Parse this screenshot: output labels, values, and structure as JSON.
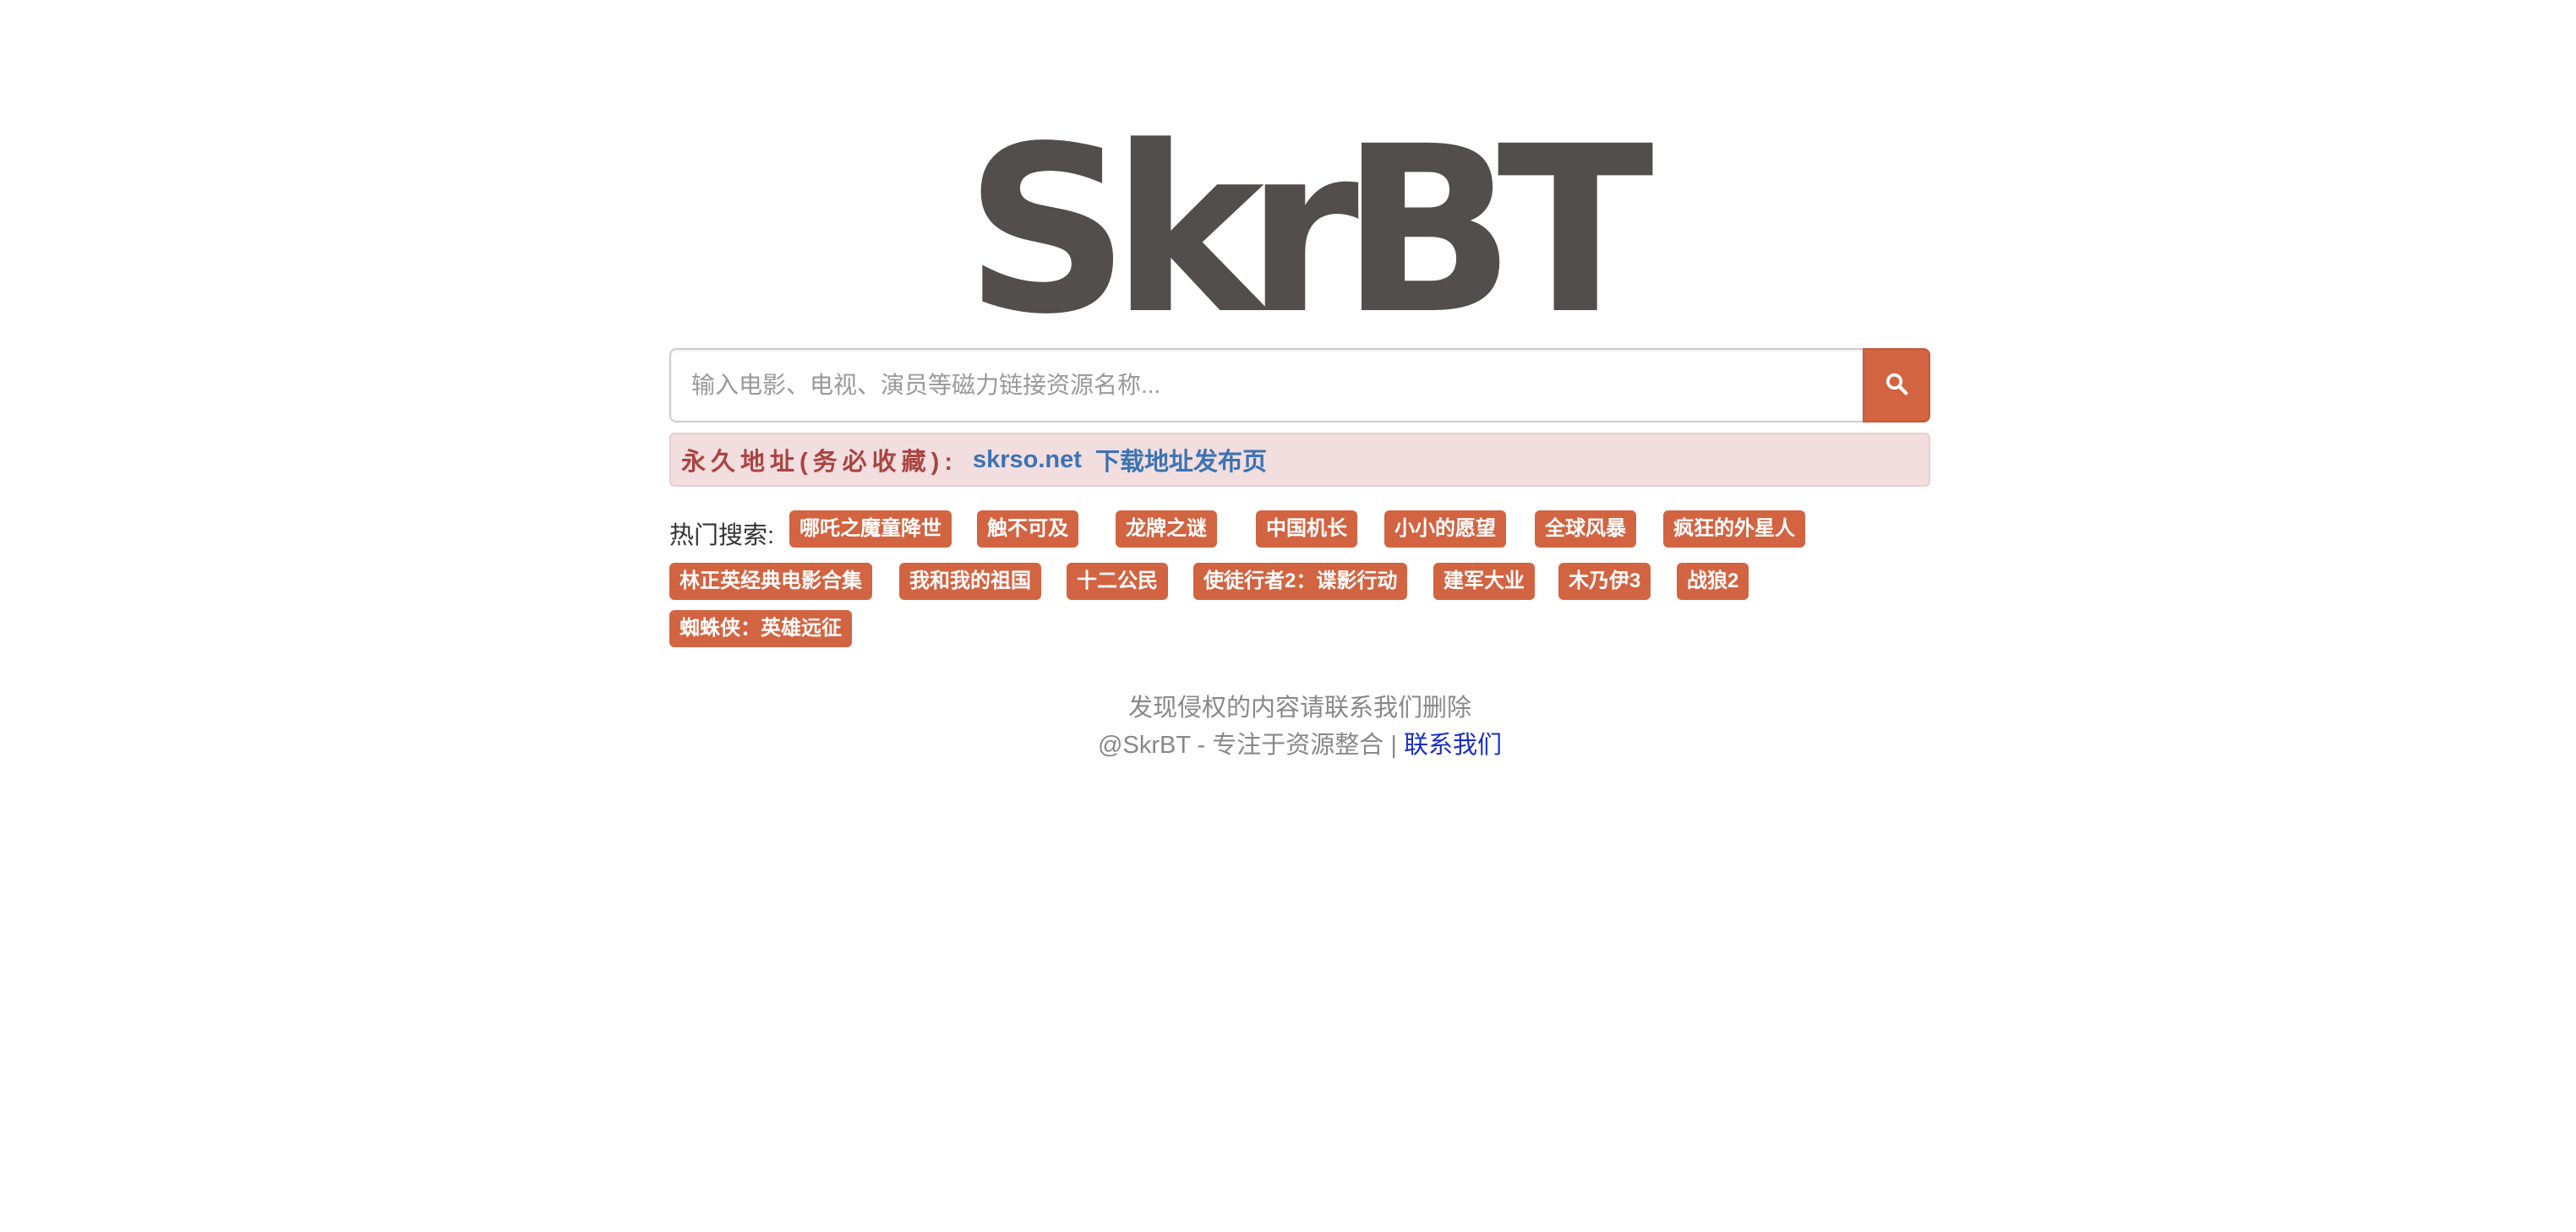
{
  "logo": {
    "text": "SkrBT"
  },
  "search": {
    "placeholder": "输入电影、电视、演员等磁力链接资源名称...",
    "button_icon": "search-icon"
  },
  "notice": {
    "label": "永久地址(务必收藏):",
    "link1": "skrso.net",
    "link2": "下载地址发布页"
  },
  "hot": {
    "title": "热门搜索:",
    "tags": [
      "哪吒之魔童降世",
      "触不可及",
      "龙牌之谜",
      "中国机长",
      "小小的愿望",
      "全球风暴",
      "疯狂的外星人",
      "林正英经典电影合集",
      "我和我的祖国",
      "十二公民",
      "使徒行者2：谍影行动",
      "建军大业",
      "木乃伊3",
      "战狼2",
      "蜘蛛侠：英雄远征"
    ]
  },
  "footer": {
    "line1": "发现侵权的内容请联系我们删除",
    "line2_prefix": "@SkrBT - 专注于资源整合 | ",
    "contact_link": "联系我们"
  },
  "colors": {
    "accent": "#d26442",
    "logo": "#534e4e",
    "notice_bg": "#f2dede",
    "notice_label": "#a94442",
    "notice_link": "#3c73b4",
    "footer_link": "#1a2fc2"
  }
}
